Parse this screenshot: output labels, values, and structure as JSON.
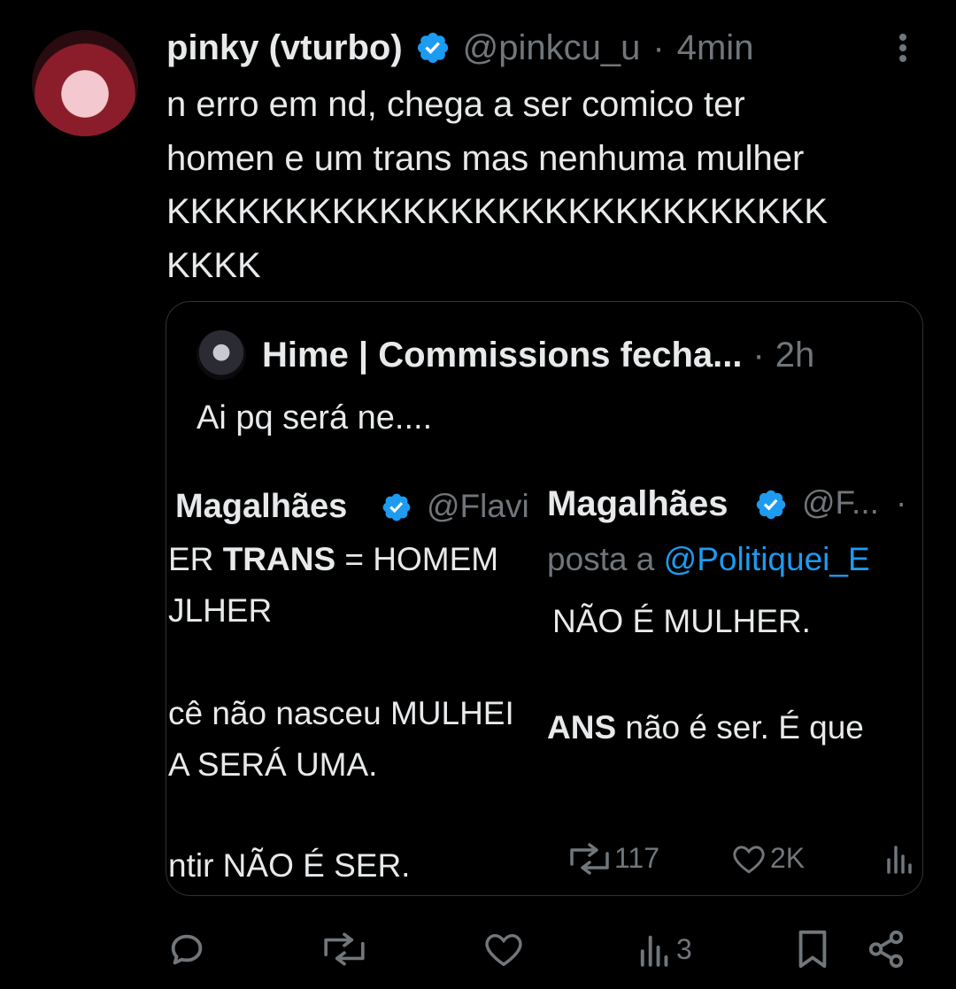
{
  "tweet": {
    "name": "pinky (vturbo)",
    "handle": "@pinkcu_u",
    "separator": "·",
    "time": "4min",
    "lines": [
      "n erro em nd, chega a ser comico ter",
      "homen e um trans mas nenhuma mulher",
      "KKKKKKKKKKKKKKKKKKKKKKKKKKKK",
      "KKKK"
    ]
  },
  "quote": {
    "name": "Hime | Commissions fecha...",
    "separator": "·",
    "time": "2h",
    "text": "Ai pq será ne....",
    "screenshot_left": {
      "name": "Magalhães",
      "handle": "@Flavi",
      "line1_prefix": "ER",
      "line1_bold": "TRANS",
      "line1_rest": "= HOMEM",
      "line2": "JLHER",
      "line3": "cê não nasceu MULHEI",
      "line4": "A SERÁ UMA.",
      "line5": "ntir NÃO É SER."
    },
    "screenshot_right": {
      "name": "Magalhães",
      "handle": "@F...",
      "dot": "·",
      "reply_prefix": "posta a",
      "reply_mention": "@Politiquei_E",
      "line1": "NÃO É MULHER.",
      "line2_bold": "ANS",
      "line2_rest": "não é ser. É que",
      "retweets": "117",
      "likes": "2K"
    }
  },
  "actions": {
    "views": "3"
  },
  "colors": {
    "background": "#000000",
    "text": "#e7e9ea",
    "muted": "#71767b",
    "verified": "#1d9bf0",
    "border": "#2f3336"
  }
}
